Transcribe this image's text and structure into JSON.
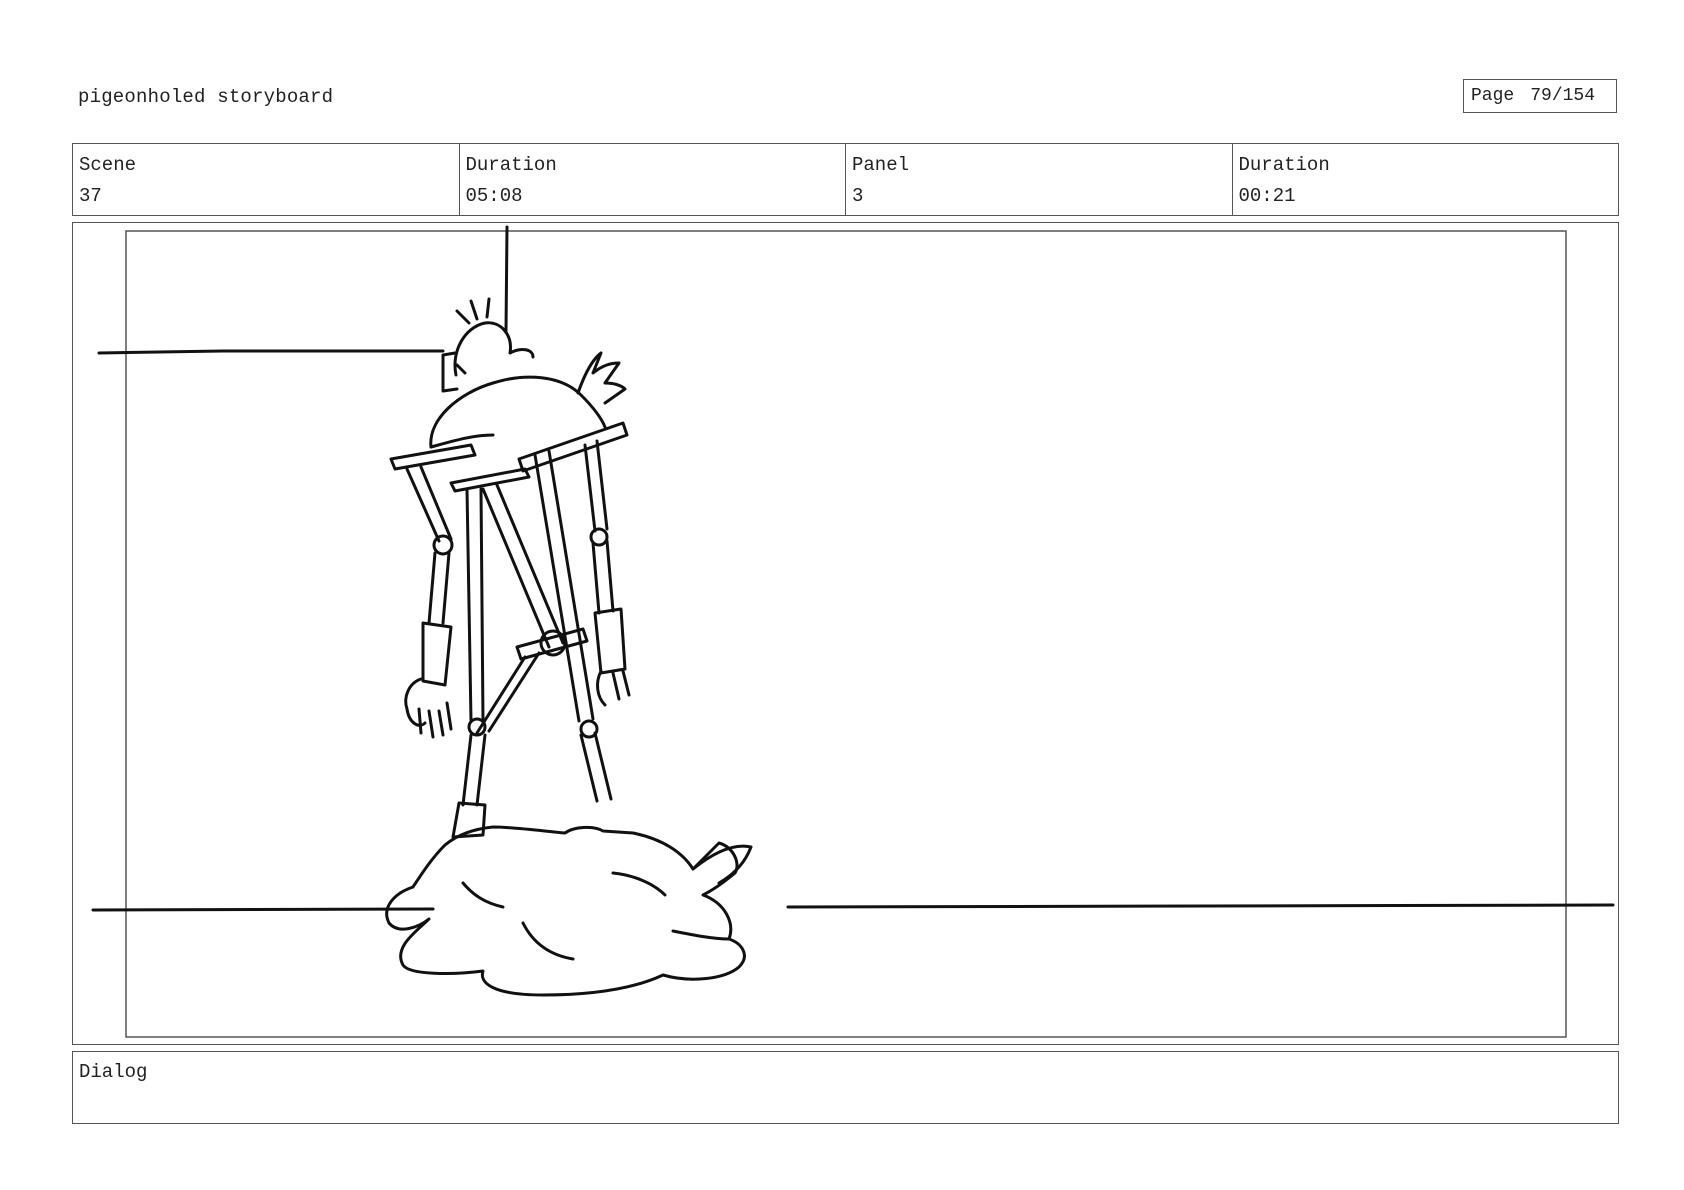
{
  "header": {
    "title": "pigeonholed storyboard",
    "page_label": "Page",
    "page_number": "79/154"
  },
  "info": {
    "scene_label": "Scene",
    "scene_value": "37",
    "scene_duration_label": "Duration",
    "scene_duration_value": "05:08",
    "panel_label": "Panel",
    "panel_value": "3",
    "panel_duration_label": "Duration",
    "panel_duration_value": "00:21"
  },
  "dialog": {
    "label": "Dialog",
    "text": ""
  },
  "colors": {
    "border": "#555555",
    "ink": "#111111",
    "text": "#222222"
  }
}
